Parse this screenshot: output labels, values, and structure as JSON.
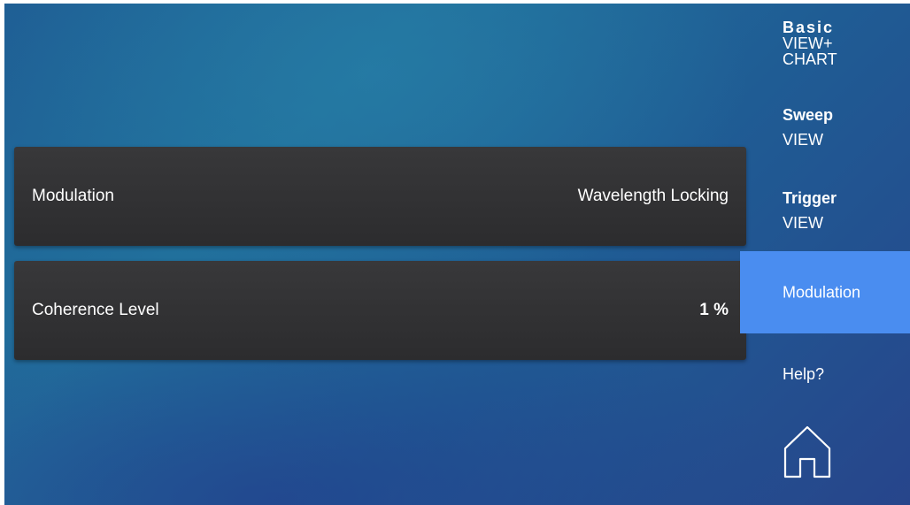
{
  "panels": [
    {
      "label": "Modulation",
      "value": "Wavelength Locking"
    },
    {
      "label": "Coherence Level",
      "value": "1 %"
    }
  ],
  "nav": {
    "basic": {
      "title": "Basic",
      "line1": "VIEW+",
      "line2": "CHART"
    },
    "sweep": {
      "title": "Sweep",
      "sub": "VIEW"
    },
    "trigger": {
      "title": "Trigger",
      "sub": "VIEW"
    },
    "modulation": {
      "label": "Modulation",
      "active": true
    },
    "help": {
      "label": "Help?"
    },
    "home": {
      "icon": "home-icon"
    }
  },
  "colors": {
    "active_nav": "#4a8df0",
    "panel_bg": "#333335",
    "text": "#ffffff"
  }
}
